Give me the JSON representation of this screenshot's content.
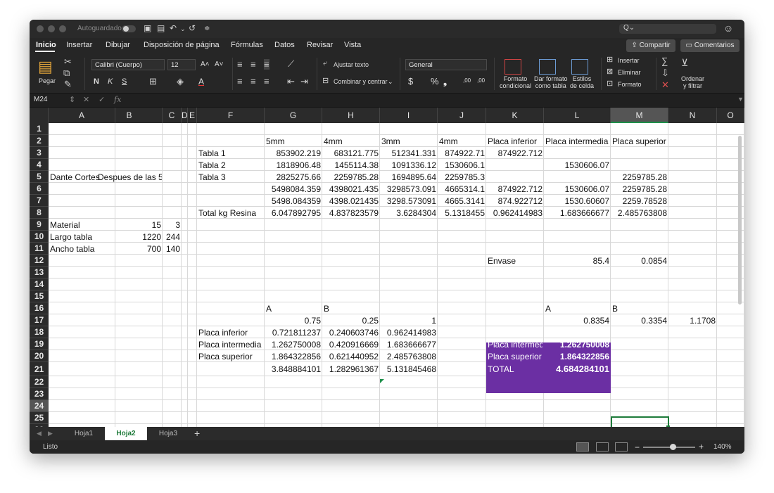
{
  "titlebar": {
    "autosave": "Autoguardado",
    "search_glyph": "Q⌄"
  },
  "ribbon_tabs": [
    "Inicio",
    "Insertar",
    "Dibujar",
    "Disposición de página",
    "Fórmulas",
    "Datos",
    "Revisar",
    "Vista"
  ],
  "share": {
    "share_label": "Compartir",
    "comments_label": "Comentarios"
  },
  "ribbon": {
    "paste": "Pegar",
    "font_name": "Calibri (Cuerpo)",
    "font_size": "12",
    "wrap_text": "Ajustar texto",
    "merge_center": "Combinar y centrar",
    "number_format": "General",
    "cond_format": [
      "Formato",
      "condicional"
    ],
    "format_table": [
      "Dar formato",
      "como tabla"
    ],
    "cell_styles": [
      "Estilos",
      "de celda"
    ],
    "insert": "Insertar",
    "delete": "Eliminar",
    "format": "Formato",
    "sort_filter": [
      "Ordenar",
      "y filtrar"
    ]
  },
  "formula_bar": {
    "name_box": "M24",
    "fx": "fx"
  },
  "columns": [
    "A",
    "B",
    "C",
    "D",
    "E",
    "F",
    "G",
    "H",
    "I",
    "J",
    "K",
    "L",
    "M",
    "N",
    "O"
  ],
  "rows": [
    "1",
    "2",
    "3",
    "4",
    "5",
    "6",
    "7",
    "8",
    "9",
    "10",
    "11",
    "12",
    "13",
    "14",
    "15",
    "16",
    "17",
    "18",
    "19",
    "20",
    "21",
    "22",
    "23",
    "24",
    "25",
    "26"
  ],
  "cells": {
    "G2": "5mm",
    "H2": "4mm",
    "I2": "3mm",
    "J2": "4mm",
    "K2": "Placa inferior",
    "L2": "Placa intermedia",
    "M2": "Placa superior",
    "F3": "Tabla 1",
    "G3": "853902.219",
    "H3": "683121.775",
    "I3": "512341.331",
    "J3": "874922.71",
    "K3": "874922.712",
    "F4": "Tabla 2",
    "G4": "1818906.48",
    "H4": "1455114.38",
    "I4": "1091336.12",
    "J4": "1530606.1",
    "L4": "1530606.07",
    "A5": "Dante Cortes",
    "B5": "Despues de las 5",
    "F5": "Tabla 3",
    "G5": "2825275.66",
    "H5": "2259785.28",
    "I5": "1694895.64",
    "J5": "2259785.3",
    "M5": "2259785.28",
    "G6": "5498084.359",
    "H6": "4398021.435",
    "I6": "3298573.091",
    "J6": "4665314.1",
    "K6": "874922.712",
    "L6": "1530606.07",
    "M6": "2259785.28",
    "G7": "5498.084359",
    "H7": "4398.021435",
    "I7": "3298.573091",
    "J7": "4665.3141",
    "K7": "874.922712",
    "L7": "1530.60607",
    "M7": "2259.78528",
    "F8": "Total  kg Resina",
    "G8": "6.047892795",
    "H8": "4.837823579",
    "I8": "3.6284304",
    "J8": "5.1318455",
    "K8": "0.962414983",
    "L8": "1.683666677",
    "M8": "2.485763808",
    "A9": "Material",
    "B9": "15",
    "C9": "3",
    "A10": "Largo tabla",
    "B10": "1220",
    "C10": "244",
    "A11": "Ancho tabla",
    "B11": "700",
    "C11": "140",
    "K12": "Envase",
    "L12": "85.4",
    "M12": "0.0854",
    "G16": "A",
    "H16": "B",
    "L16": "A",
    "M16": "B",
    "G17": "0.75",
    "H17": "0.25",
    "I17": "1",
    "L17": "0.8354",
    "M17": "0.3354",
    "N17": "1.1708",
    "F18": "Placa inferior",
    "G18": "0.721811237",
    "H18": "0.240603746",
    "I18": "0.962414983",
    "K18": "Placa inferior",
    "L18": "0.721811237",
    "F19": "Placa intermedia",
    "G19": "1.262750008",
    "H19": "0.420916669",
    "I19": "1.683666677",
    "K19": "Placa intermed",
    "L19": "1.262750008",
    "F20": "Placa superior",
    "G20": "1.864322856",
    "H20": "0.621440952",
    "I20": "2.485763808",
    "K20": "Placa superior",
    "L20": "1.864322856",
    "G21": "3.848884101",
    "H21": "1.282961367",
    "I21": "5.131845468",
    "K21": "TOTAL",
    "L21": "4.684284101"
  },
  "sheets": [
    "Hoja1",
    "Hoja2",
    "Hoja3"
  ],
  "active_sheet": "Hoja2",
  "status": {
    "ready": "Listo",
    "zoom": "140%"
  },
  "colors": {
    "accent_green": "#1e7b3a",
    "purple_fill": "#6b2fa3"
  }
}
